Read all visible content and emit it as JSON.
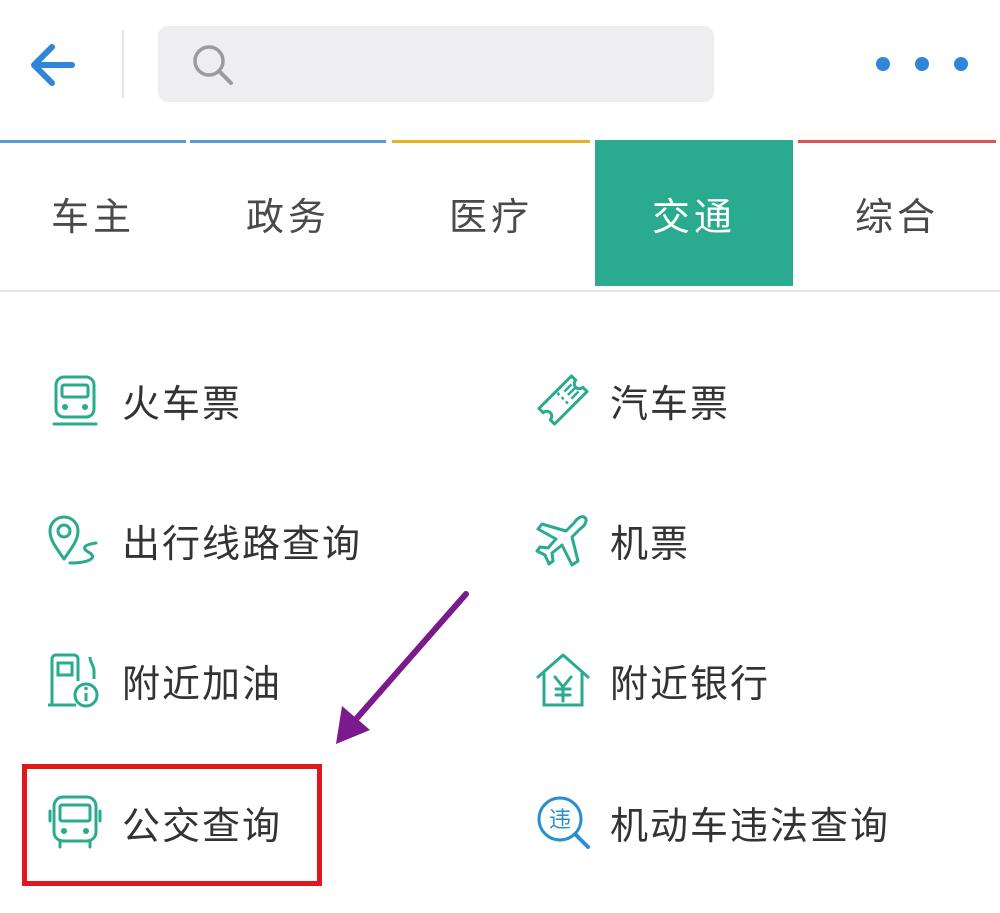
{
  "header": {
    "back_icon": "back-arrow-icon",
    "search_icon": "search-icon",
    "search_placeholder": "",
    "search_value": "",
    "more_icon": "more-dots-icon",
    "accent_color": "#2f86d6"
  },
  "tabs": {
    "active_color": "#2aab8f",
    "items": [
      {
        "label": "车主",
        "line_color": "#5b9bd5"
      },
      {
        "label": "政务",
        "line_color": "#5b9bd5"
      },
      {
        "label": "医疗",
        "line_color": "#e6b422"
      },
      {
        "label": "交通",
        "line_color": "#2aab8f",
        "active": true
      },
      {
        "label": "综合",
        "line_color": "#d9534f"
      }
    ]
  },
  "services": [
    {
      "label": "火车票",
      "icon": "train-icon"
    },
    {
      "label": "汽车票",
      "icon": "ticket-icon"
    },
    {
      "label": "出行线路查询",
      "icon": "route-pin-icon"
    },
    {
      "label": "机票",
      "icon": "airplane-icon"
    },
    {
      "label": "附近加油",
      "icon": "gas-station-icon"
    },
    {
      "label": "附近银行",
      "icon": "bank-house-icon"
    },
    {
      "label": "公交查询",
      "icon": "bus-icon"
    },
    {
      "label": "机动车违法查询",
      "icon": "violation-search-icon"
    }
  ],
  "annotations": {
    "highlight_color": "#e0171f",
    "arrow_color": "#7b1a8c"
  }
}
